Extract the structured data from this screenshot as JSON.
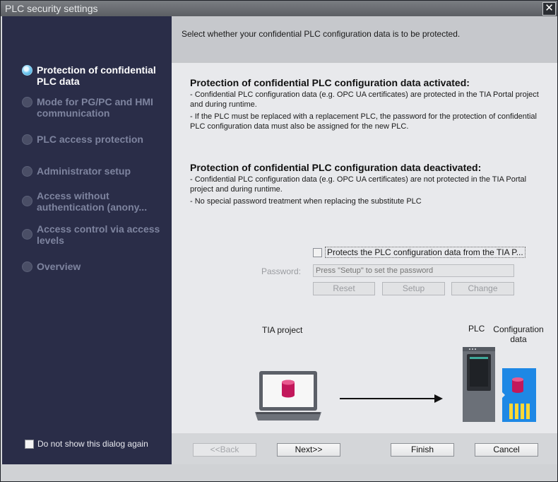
{
  "window": {
    "title": "PLC security settings",
    "close_glyph": "✕"
  },
  "sidebar": {
    "items": [
      {
        "label": "Protection of confidential PLC data",
        "active": true
      },
      {
        "label": "Mode for PG/PC and HMI communication",
        "active": false
      },
      {
        "label": "PLC access protection",
        "active": false
      },
      {
        "label": "Administrator setup",
        "active": false
      },
      {
        "label": "Access without authentication (anony...",
        "active": false
      },
      {
        "label": "Access control via access levels",
        "active": false
      },
      {
        "label": "Overview",
        "active": false
      }
    ],
    "dont_show_label": "Do not show this dialog again"
  },
  "main": {
    "header_text": "Select whether your confidential PLC configuration data is to be protected.",
    "activated": {
      "title": "Protection of confidential PLC configuration data activated:",
      "line1": "- Confidential PLC configuration data (e.g. OPC UA certificates) are protected in the TIA Portal project and during runtime.",
      "line2": "- If the PLC must be replaced with a replacement PLC, the password for the protection of confidential PLC configuration data must also be assigned for the new PLC."
    },
    "deactivated": {
      "title": "Protection of confidential PLC configuration data deactivated:",
      "line1": "- Confidential PLC configuration data (e.g. OPC UA certificates) are not protected in the TIA Portal project and during runtime.",
      "line2": "- No special password treatment when replacing the substitute PLC"
    },
    "protect_checkbox_label": "Protects the PLC configuration data from the TIA P...",
    "password_label": "Password:",
    "password_placeholder": "Press \"Setup\" to set the password",
    "reset_label": "Reset",
    "setup_label": "Setup",
    "change_label": "Change",
    "diagram": {
      "tia_label": "TIA project",
      "plc_label": "PLC",
      "config_label": "Configuration data"
    }
  },
  "footer": {
    "back_label": "<<Back",
    "next_label": "Next>>",
    "finish_label": "Finish",
    "cancel_label": "Cancel"
  },
  "colors": {
    "sidebar_bg": "#2a2d48",
    "active_dot": "#7fd0f5",
    "cylinder": "#c2185b",
    "sd_card": "#1e88e5",
    "sd_contacts": "#fdd835"
  }
}
